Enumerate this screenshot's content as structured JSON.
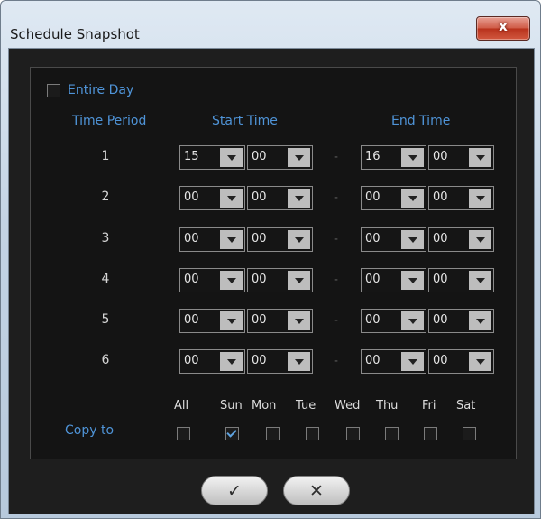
{
  "window": {
    "title": "Schedule Snapshot",
    "close_glyph": "x"
  },
  "entire_day": {
    "label": "Entire Day",
    "checked": false
  },
  "headers": {
    "time_period": "Time Period",
    "start_time": "Start Time",
    "end_time": "End Time"
  },
  "separator": "-",
  "rows": [
    {
      "num": "1",
      "start_h": "15",
      "start_m": "00",
      "end_h": "16",
      "end_m": "00"
    },
    {
      "num": "2",
      "start_h": "00",
      "start_m": "00",
      "end_h": "00",
      "end_m": "00"
    },
    {
      "num": "3",
      "start_h": "00",
      "start_m": "00",
      "end_h": "00",
      "end_m": "00"
    },
    {
      "num": "4",
      "start_h": "00",
      "start_m": "00",
      "end_h": "00",
      "end_m": "00"
    },
    {
      "num": "5",
      "start_h": "00",
      "start_m": "00",
      "end_h": "00",
      "end_m": "00"
    },
    {
      "num": "6",
      "start_h": "00",
      "start_m": "00",
      "end_h": "00",
      "end_m": "00"
    }
  ],
  "copy_to": {
    "label": "Copy to",
    "days": [
      {
        "label": "All",
        "checked": false
      },
      {
        "label": "Sun",
        "checked": true
      },
      {
        "label": "Mon",
        "checked": false
      },
      {
        "label": "Tue",
        "checked": false
      },
      {
        "label": "Wed",
        "checked": false
      },
      {
        "label": "Thu",
        "checked": false
      },
      {
        "label": "Fri",
        "checked": false
      },
      {
        "label": "Sat",
        "checked": false
      }
    ]
  },
  "buttons": {
    "ok_glyph": "✓",
    "cancel_glyph": "✕"
  },
  "colors": {
    "accent_blue": "#4f94d8",
    "panel_bg": "#141414",
    "close_red": "#c8412b"
  }
}
